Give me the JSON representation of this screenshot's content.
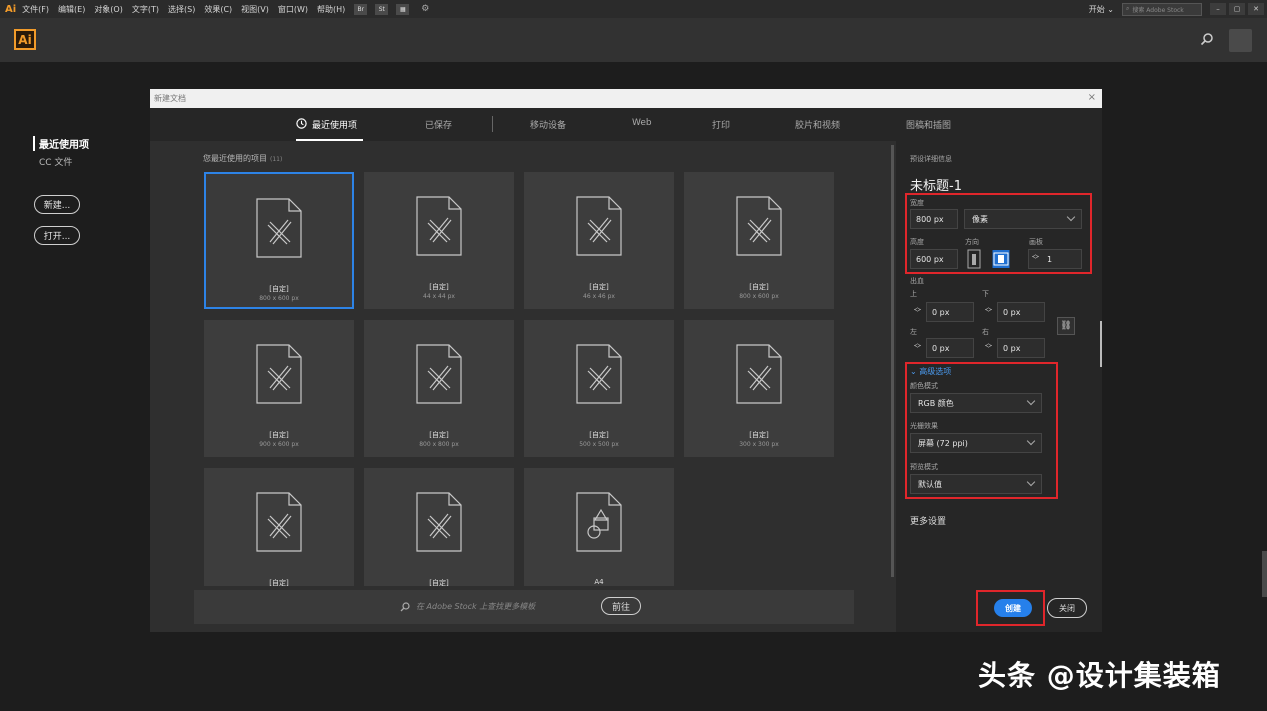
{
  "menubar": {
    "logo": "Ai",
    "items": [
      "文件(F)",
      "编辑(E)",
      "对象(O)",
      "文字(T)",
      "选择(S)",
      "效果(C)",
      "视图(V)",
      "窗口(W)",
      "帮助(H)"
    ],
    "mini_buttons": [
      "Br",
      "St"
    ],
    "workspace": "开始 ⌄",
    "search_placeholder": "搜索 Adobe Stock",
    "window_controls": [
      "–",
      "▢",
      "✕"
    ]
  },
  "homebar": {
    "logo": "Ai",
    "search_icon": "search-icon"
  },
  "start_panel": {
    "recent": "最近使用项",
    "cc_files": "CC 文件",
    "new_button": "新建...",
    "open_button": "打开..."
  },
  "dialog": {
    "title": "新建文档",
    "close": "×",
    "tabs": [
      "最近使用项",
      "已保存",
      "移动设备",
      "Web",
      "打印",
      "胶片和视频",
      "图稿和插图"
    ],
    "recent_label": "您最近使用的项目",
    "recent_count": "(11)",
    "presets": [
      {
        "name": "[自定]",
        "size": "800 x 600 px",
        "icon": "custom-doc-icon"
      },
      {
        "name": "[自定]",
        "size": "44 x 44 px",
        "icon": "custom-doc-icon"
      },
      {
        "name": "[自定]",
        "size": "46 x 46 px",
        "icon": "custom-doc-icon"
      },
      {
        "name": "[自定]",
        "size": "800 x 600 px",
        "icon": "custom-doc-icon"
      },
      {
        "name": "[自定]",
        "size": "900 x 600 px",
        "icon": "custom-doc-icon"
      },
      {
        "name": "[自定]",
        "size": "800 x 800 px",
        "icon": "custom-doc-icon"
      },
      {
        "name": "[自定]",
        "size": "500 x 500 px",
        "icon": "custom-doc-icon"
      },
      {
        "name": "[自定]",
        "size": "300 x 300 px",
        "icon": "custom-doc-icon"
      },
      {
        "name": "[自定]",
        "size": "",
        "icon": "custom-doc-icon"
      },
      {
        "name": "[自定]",
        "size": "",
        "icon": "custom-doc-icon"
      },
      {
        "name": "A4",
        "size": "",
        "icon": "shapes-doc-icon"
      }
    ],
    "stock_search": "在 Adobe Stock 上查找更多模板",
    "stock_go": "前往",
    "details": {
      "header": "预设详细信息",
      "doc_name": "未标题-1",
      "width_label": "宽度",
      "width_value": "800 px",
      "unit": "像素",
      "height_label": "高度",
      "height_value": "600 px",
      "orientation_label": "方向",
      "artboards_label": "画板",
      "artboards_value": "1",
      "bleed_label": "出血",
      "top_label": "上",
      "bottom_label": "下",
      "left_label": "左",
      "right_label": "右",
      "bleed_top": "0 px",
      "bleed_bottom": "0 px",
      "bleed_left": "0 px",
      "bleed_right": "0 px",
      "advanced_label": "高级选项",
      "color_mode_label": "颜色模式",
      "color_mode": "RGB 颜色",
      "raster_label": "光栅效果",
      "raster": "屏幕 (72 ppi)",
      "preview_label": "预览模式",
      "preview": "默认值",
      "more_settings": "更多设置",
      "create": "创建",
      "close": "关闭"
    }
  },
  "watermark": "头条 @设计集装箱",
  "colors": {
    "accent": "#2680eb",
    "highlight": "#e0262b",
    "brand": "#f29b2a"
  }
}
